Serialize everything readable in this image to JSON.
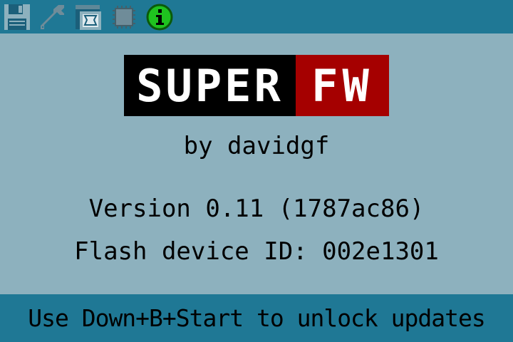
{
  "app": {
    "logo_left": "SUPER",
    "logo_right": "FW"
  },
  "toolbar": {
    "icons": [
      {
        "name": "save-icon"
      },
      {
        "name": "wrench-icon"
      },
      {
        "name": "rom-window-icon"
      },
      {
        "name": "chip-icon"
      },
      {
        "name": "info-icon"
      }
    ]
  },
  "main": {
    "author": "by davidgf",
    "version": "Version 0.11 (1787ac86)",
    "flash_id": "Flash device ID: 002e1301"
  },
  "status": {
    "hint": "Use Down+B+Start to unlock updates"
  },
  "colors": {
    "bar": "#1f7895",
    "background": "#8db1be",
    "logo_dark": "#000000",
    "logo_accent": "#a50000"
  }
}
